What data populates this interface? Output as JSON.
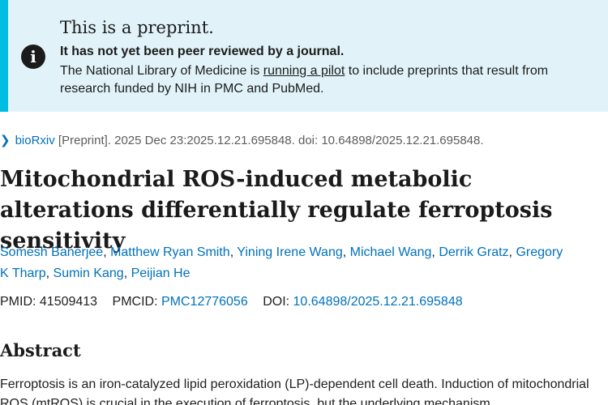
{
  "banner": {
    "title": "This is a preprint.",
    "subtitle": "It has not yet been peer reviewed by a journal.",
    "text_before": "The National Library of Medicine is ",
    "link": "running a pilot",
    "text_after": " to include preprints that result from research funded by NIH in PMC and PubMed.",
    "icon": "info-icon"
  },
  "citation": {
    "journal": "bioRxiv",
    "rest": " [Preprint]. 2025 Dec 23:2025.12.21.695848. doi: 10.64898/2025.12.21.695848."
  },
  "article": {
    "title": "Mitochondrial ROS-induced metabolic alterations differentially regulate ferroptosis sensitivity"
  },
  "authors": [
    "Somesh Banerjee",
    "Matthew Ryan Smith",
    "Yining Irene Wang",
    "Michael Wang",
    "Derrik Gratz",
    "Gregory K Tharp",
    "Sumin Kang",
    "Peijian He"
  ],
  "ids": {
    "pmid_label": "PMID: 41509413",
    "pmcid_label": "PMCID: ",
    "pmcid": "PMC12776056",
    "doi_label": "DOI: ",
    "doi": "10.64898/2025.12.21.695848"
  },
  "abstract": {
    "heading": "Abstract",
    "text": "Ferroptosis is an iron-catalyzed lipid peroxidation (LP)-dependent cell death. Induction of mitochondrial ROS (mtROS) is crucial in the execution of ferroptosis, but the underlying mechanism"
  },
  "colors": {
    "banner_bg": "#e1f3f8",
    "banner_accent": "#00bde3",
    "link": "#0071bc"
  }
}
